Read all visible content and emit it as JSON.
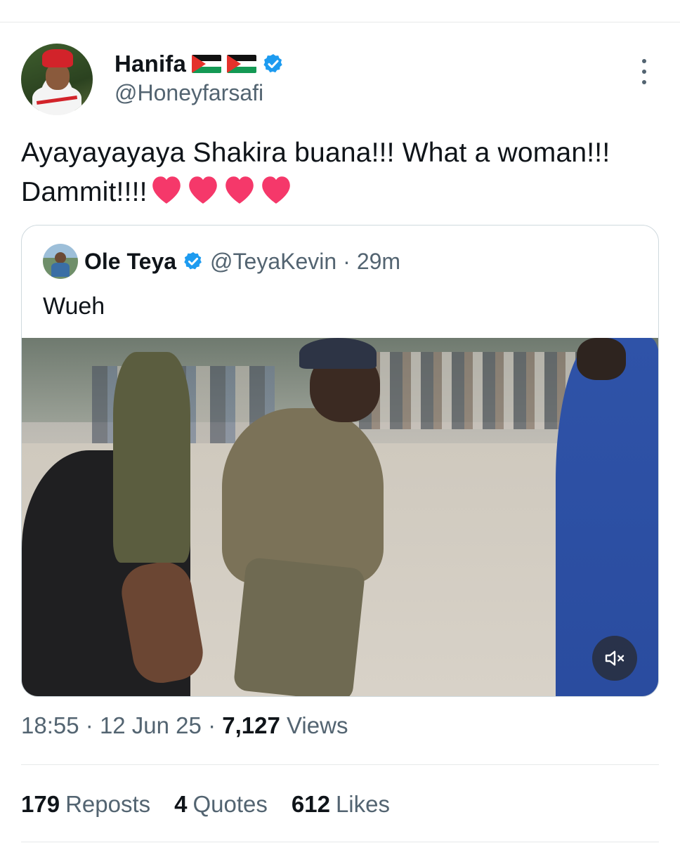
{
  "author": {
    "display_name": "Hanifa",
    "handle": "@Honeyfarsafi",
    "flags": [
      "palestine-flag",
      "palestine-flag"
    ],
    "verified": true
  },
  "tweet": {
    "text": "Ayayayayaya Shakira buana!!! What a woman!!! Dammit!!!!",
    "emoji": [
      "heart",
      "heart",
      "heart",
      "heart"
    ]
  },
  "quoted": {
    "display_name": "Ole Teya",
    "handle": "@TeyaKevin",
    "separator": "·",
    "time": "29m",
    "text": "Wueh",
    "verified": true
  },
  "meta": {
    "time": "18:55",
    "date": "12 Jun 25",
    "views_count": "7,127",
    "views_label": "Views",
    "separator": "·"
  },
  "stats": {
    "reposts_count": "179",
    "reposts_label": "Reposts",
    "quotes_count": "4",
    "quotes_label": "Quotes",
    "likes_count": "612",
    "likes_label": "Likes"
  },
  "colors": {
    "verified_blue": "#1d9bf0",
    "secondary_text": "#536471",
    "heart_pink": "#f5386a"
  },
  "icons": [
    "more-vertical-icon",
    "verified-badge-icon",
    "heart-emoji",
    "mute-icon"
  ]
}
